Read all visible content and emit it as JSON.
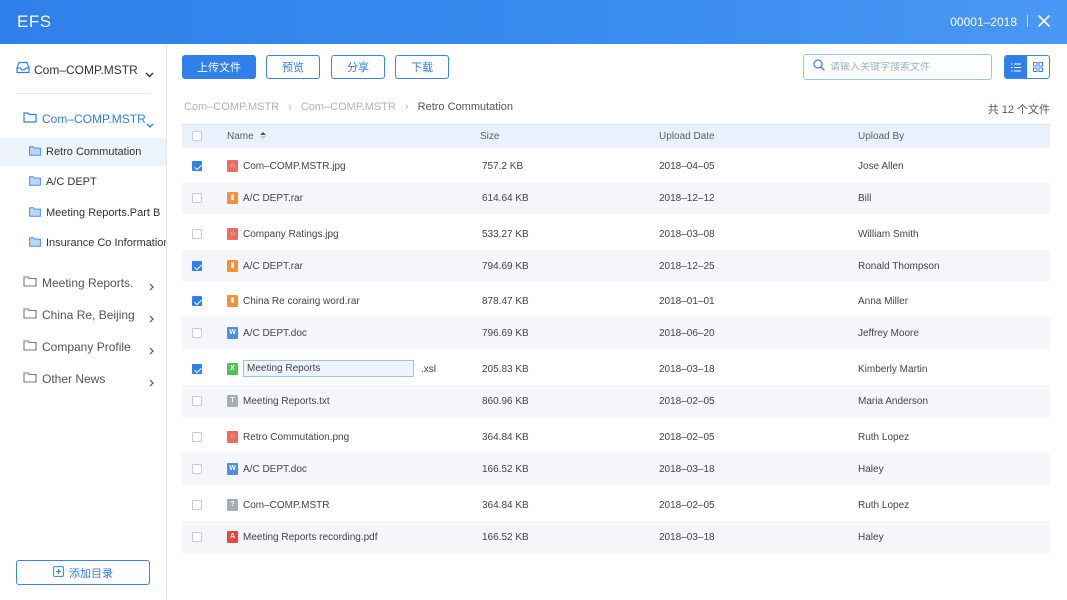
{
  "titlebar": {
    "app_name": "EFS",
    "code": "00001–2018",
    "close_icon": "close-icon"
  },
  "sidebar": {
    "top_label": "Com–COMP.MSTR",
    "root_label": "Com–COMP.MSTR",
    "sub_items": [
      {
        "label": "Retro Commutation",
        "active": true
      },
      {
        "label": "A/C DEPT",
        "active": false
      },
      {
        "label": "Meeting Reports.Part B",
        "active": false
      },
      {
        "label": "Insurance Co Information",
        "active": false
      }
    ],
    "items": [
      {
        "label": "Meeting Reports."
      },
      {
        "label": "China Re, Beijing"
      },
      {
        "label": "Company Profile"
      },
      {
        "label": "Other News"
      }
    ],
    "add_label": "添加目录"
  },
  "toolbar": {
    "upload_label": "上传文件",
    "preview_label": "预览",
    "share_label": "分享",
    "download_label": "下载",
    "search_placeholder": "请输入关键字搜索文件",
    "view_mode": "list"
  },
  "breadcrumb": [
    "Com–COMP.MSTR",
    "Com–COMP.MSTR",
    "Retro Commutation"
  ],
  "file_count": "共 12 个文件",
  "table": {
    "headers": {
      "name": "Name",
      "size": "Size",
      "date": "Upload Date",
      "user": "Upload By"
    },
    "rows": [
      {
        "name": "Com–COMP.MSTR.jpg",
        "type": "img",
        "size": "757.2 KB",
        "date": "2018–04–05",
        "user": "Jose Allen",
        "checked": true
      },
      {
        "name": "A/C DEPT.rar",
        "type": "rar",
        "size": "614.64 KB",
        "date": "2018–12–12",
        "user": "Bill",
        "checked": false
      },
      {
        "name": "Company Ratings.jpg",
        "type": "img",
        "size": "533.27 KB",
        "date": "2018–03–08",
        "user": "William Smith",
        "checked": false
      },
      {
        "name": "A/C DEPT.rar",
        "type": "rar",
        "size": "794.69 KB",
        "date": "2018–12–25",
        "user": "Ronald Thompson",
        "checked": true
      },
      {
        "name": "China Re coraing word.rar",
        "type": "rar",
        "size": "878.47 KB",
        "date": "2018–01–01",
        "user": "Anna Miller",
        "checked": true
      },
      {
        "name": "A/C DEPT.doc",
        "type": "doc",
        "size": "796.69 KB",
        "date": "2018–06–20",
        "user": "Jeffrey Moore",
        "checked": false
      },
      {
        "name": "Meeting Reports",
        "ext": ".xsl",
        "type": "xls",
        "size": "205.83 KB",
        "date": "2018–03–18",
        "user": "Kimberly Martin",
        "checked": true,
        "editing": true
      },
      {
        "name": "Meeting Reports.txt",
        "type": "txt",
        "size": "860.96 KB",
        "date": "2018–02–05",
        "user": "Maria Anderson",
        "checked": false
      },
      {
        "name": "Retro Commutation.png",
        "type": "img",
        "size": "364.84 KB",
        "date": "2018–02–05",
        "user": "Ruth Lopez",
        "checked": false
      },
      {
        "name": "A/C DEPT.doc",
        "type": "doc",
        "size": "166.52 KB",
        "date": "2018–03–18",
        "user": "Haley",
        "checked": false
      },
      {
        "name": "Com–COMP.MSTR",
        "type": "unknown",
        "size": "364.84 KB",
        "date": "2018–02–05",
        "user": "Ruth Lopez",
        "checked": false
      },
      {
        "name": "Meeting Reports recording.pdf",
        "type": "pdf",
        "size": "166.52 KB",
        "date": "2018–03–18",
        "user": "Haley",
        "checked": false
      }
    ]
  },
  "colors": {
    "accent": "#2f80ea",
    "img": "#ee6b5e",
    "rar": "#f2913d",
    "doc": "#4a8fe8",
    "xls": "#52c15a",
    "txt": "#a6adb6",
    "unknown": "#a6adb6",
    "pdf": "#e8493f"
  }
}
